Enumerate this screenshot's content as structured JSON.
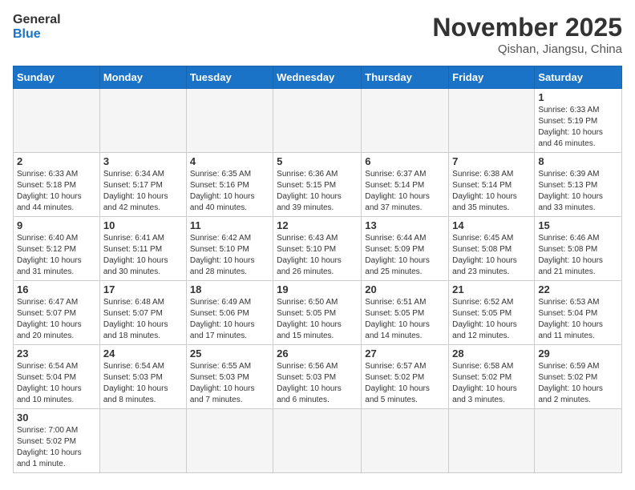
{
  "logo": {
    "text_general": "General",
    "text_blue": "Blue"
  },
  "title": "November 2025",
  "location": "Qishan, Jiangsu, China",
  "days_of_week": [
    "Sunday",
    "Monday",
    "Tuesday",
    "Wednesday",
    "Thursday",
    "Friday",
    "Saturday"
  ],
  "weeks": [
    [
      {
        "day": "",
        "info": ""
      },
      {
        "day": "",
        "info": ""
      },
      {
        "day": "",
        "info": ""
      },
      {
        "day": "",
        "info": ""
      },
      {
        "day": "",
        "info": ""
      },
      {
        "day": "",
        "info": ""
      },
      {
        "day": "1",
        "info": "Sunrise: 6:33 AM\nSunset: 5:19 PM\nDaylight: 10 hours\nand 46 minutes."
      }
    ],
    [
      {
        "day": "2",
        "info": "Sunrise: 6:33 AM\nSunset: 5:18 PM\nDaylight: 10 hours\nand 44 minutes."
      },
      {
        "day": "3",
        "info": "Sunrise: 6:34 AM\nSunset: 5:17 PM\nDaylight: 10 hours\nand 42 minutes."
      },
      {
        "day": "4",
        "info": "Sunrise: 6:35 AM\nSunset: 5:16 PM\nDaylight: 10 hours\nand 40 minutes."
      },
      {
        "day": "5",
        "info": "Sunrise: 6:36 AM\nSunset: 5:15 PM\nDaylight: 10 hours\nand 39 minutes."
      },
      {
        "day": "6",
        "info": "Sunrise: 6:37 AM\nSunset: 5:14 PM\nDaylight: 10 hours\nand 37 minutes."
      },
      {
        "day": "7",
        "info": "Sunrise: 6:38 AM\nSunset: 5:14 PM\nDaylight: 10 hours\nand 35 minutes."
      },
      {
        "day": "8",
        "info": "Sunrise: 6:39 AM\nSunset: 5:13 PM\nDaylight: 10 hours\nand 33 minutes."
      }
    ],
    [
      {
        "day": "9",
        "info": "Sunrise: 6:40 AM\nSunset: 5:12 PM\nDaylight: 10 hours\nand 31 minutes."
      },
      {
        "day": "10",
        "info": "Sunrise: 6:41 AM\nSunset: 5:11 PM\nDaylight: 10 hours\nand 30 minutes."
      },
      {
        "day": "11",
        "info": "Sunrise: 6:42 AM\nSunset: 5:10 PM\nDaylight: 10 hours\nand 28 minutes."
      },
      {
        "day": "12",
        "info": "Sunrise: 6:43 AM\nSunset: 5:10 PM\nDaylight: 10 hours\nand 26 minutes."
      },
      {
        "day": "13",
        "info": "Sunrise: 6:44 AM\nSunset: 5:09 PM\nDaylight: 10 hours\nand 25 minutes."
      },
      {
        "day": "14",
        "info": "Sunrise: 6:45 AM\nSunset: 5:08 PM\nDaylight: 10 hours\nand 23 minutes."
      },
      {
        "day": "15",
        "info": "Sunrise: 6:46 AM\nSunset: 5:08 PM\nDaylight: 10 hours\nand 21 minutes."
      }
    ],
    [
      {
        "day": "16",
        "info": "Sunrise: 6:47 AM\nSunset: 5:07 PM\nDaylight: 10 hours\nand 20 minutes."
      },
      {
        "day": "17",
        "info": "Sunrise: 6:48 AM\nSunset: 5:07 PM\nDaylight: 10 hours\nand 18 minutes."
      },
      {
        "day": "18",
        "info": "Sunrise: 6:49 AM\nSunset: 5:06 PM\nDaylight: 10 hours\nand 17 minutes."
      },
      {
        "day": "19",
        "info": "Sunrise: 6:50 AM\nSunset: 5:05 PM\nDaylight: 10 hours\nand 15 minutes."
      },
      {
        "day": "20",
        "info": "Sunrise: 6:51 AM\nSunset: 5:05 PM\nDaylight: 10 hours\nand 14 minutes."
      },
      {
        "day": "21",
        "info": "Sunrise: 6:52 AM\nSunset: 5:05 PM\nDaylight: 10 hours\nand 12 minutes."
      },
      {
        "day": "22",
        "info": "Sunrise: 6:53 AM\nSunset: 5:04 PM\nDaylight: 10 hours\nand 11 minutes."
      }
    ],
    [
      {
        "day": "23",
        "info": "Sunrise: 6:54 AM\nSunset: 5:04 PM\nDaylight: 10 hours\nand 10 minutes."
      },
      {
        "day": "24",
        "info": "Sunrise: 6:54 AM\nSunset: 5:03 PM\nDaylight: 10 hours\nand 8 minutes."
      },
      {
        "day": "25",
        "info": "Sunrise: 6:55 AM\nSunset: 5:03 PM\nDaylight: 10 hours\nand 7 minutes."
      },
      {
        "day": "26",
        "info": "Sunrise: 6:56 AM\nSunset: 5:03 PM\nDaylight: 10 hours\nand 6 minutes."
      },
      {
        "day": "27",
        "info": "Sunrise: 6:57 AM\nSunset: 5:02 PM\nDaylight: 10 hours\nand 5 minutes."
      },
      {
        "day": "28",
        "info": "Sunrise: 6:58 AM\nSunset: 5:02 PM\nDaylight: 10 hours\nand 3 minutes."
      },
      {
        "day": "29",
        "info": "Sunrise: 6:59 AM\nSunset: 5:02 PM\nDaylight: 10 hours\nand 2 minutes."
      }
    ],
    [
      {
        "day": "30",
        "info": "Sunrise: 7:00 AM\nSunset: 5:02 PM\nDaylight: 10 hours\nand 1 minute."
      },
      {
        "day": "",
        "info": ""
      },
      {
        "day": "",
        "info": ""
      },
      {
        "day": "",
        "info": ""
      },
      {
        "day": "",
        "info": ""
      },
      {
        "day": "",
        "info": ""
      },
      {
        "day": "",
        "info": ""
      }
    ]
  ]
}
